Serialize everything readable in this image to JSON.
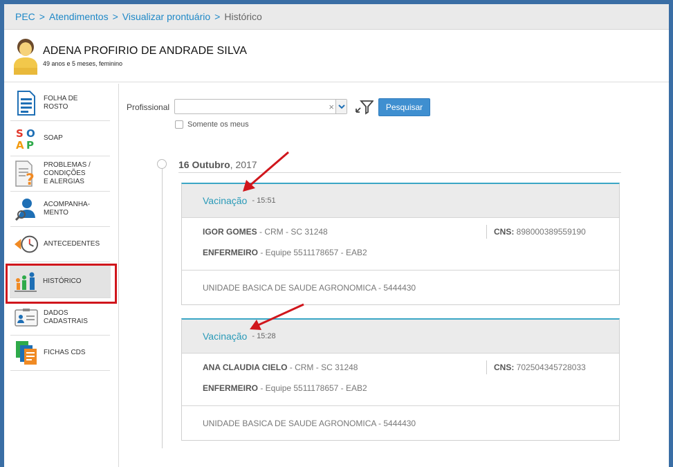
{
  "breadcrumb": {
    "items": [
      "PEC",
      "Atendimentos",
      "Visualizar prontuário"
    ],
    "separator": ">",
    "current": "Histórico"
  },
  "patient": {
    "name": "ADENA PROFIRIO DE ANDRADE SILVA",
    "info": "49 anos e 5 meses, feminino"
  },
  "sidebar": {
    "items": [
      {
        "label1": "FOLHA DE",
        "label2": "ROSTO",
        "label3": "",
        "icon": "document-icon"
      },
      {
        "label1": "SOAP",
        "label2": "",
        "label3": "",
        "icon": "soap-icon"
      },
      {
        "label1": "PROBLEMAS /",
        "label2": "CONDIÇÕES",
        "label3": "E ALERGIAS",
        "icon": "question-document-icon"
      },
      {
        "label1": "ACOMPANHA-",
        "label2": "MENTO",
        "label3": "",
        "icon": "person-search-icon"
      },
      {
        "label1": "ANTECEDENTES",
        "label2": "",
        "label3": "",
        "icon": "clock-back-icon"
      },
      {
        "label1": "HISTÓRICO",
        "label2": "",
        "label3": "",
        "icon": "family-icon"
      },
      {
        "label1": "DADOS",
        "label2": "CADASTRAIS",
        "label3": "",
        "icon": "id-card-icon"
      },
      {
        "label1": "FICHAS CDS",
        "label2": "",
        "label3": "",
        "icon": "forms-icon"
      }
    ],
    "active": "HISTÓRICO"
  },
  "filter": {
    "label": "Profissional",
    "value": "",
    "search_label": "Pesquisar",
    "checkbox_label": "Somente os meus",
    "checkbox_checked": false
  },
  "timeline": {
    "date_day": "16 Outubro",
    "date_year": ", 2017",
    "entries": [
      {
        "type": "Vacinação",
        "time": "- 15:51",
        "professional": "IGOR GOMES",
        "registry": " - CRM - SC 31248",
        "cns_label": "CNS:",
        "cns": " 898000389559190",
        "role": "ENFERMEIRO",
        "team": " - Equipe 5511178657 - EAB2",
        "unit": "UNIDADE BASICA DE SAUDE AGRONOMICA - 5444430"
      },
      {
        "type": "Vacinação",
        "time": "- 15:28",
        "professional": "ANA CLAUDIA CIELO",
        "registry": " - CRM - SC 31248",
        "cns_label": "CNS:",
        "cns": " 702504345728033",
        "role": "ENFERMEIRO",
        "team": " - Equipe 5511178657 - EAB2",
        "unit": "UNIDADE BASICA DE SAUDE AGRONOMICA - 5444430"
      }
    ]
  },
  "colors": {
    "accent": "#1e88c7",
    "title_teal": "#2a9ab8",
    "button": "#3f8fd0",
    "highlight_red": "#d0161c"
  }
}
